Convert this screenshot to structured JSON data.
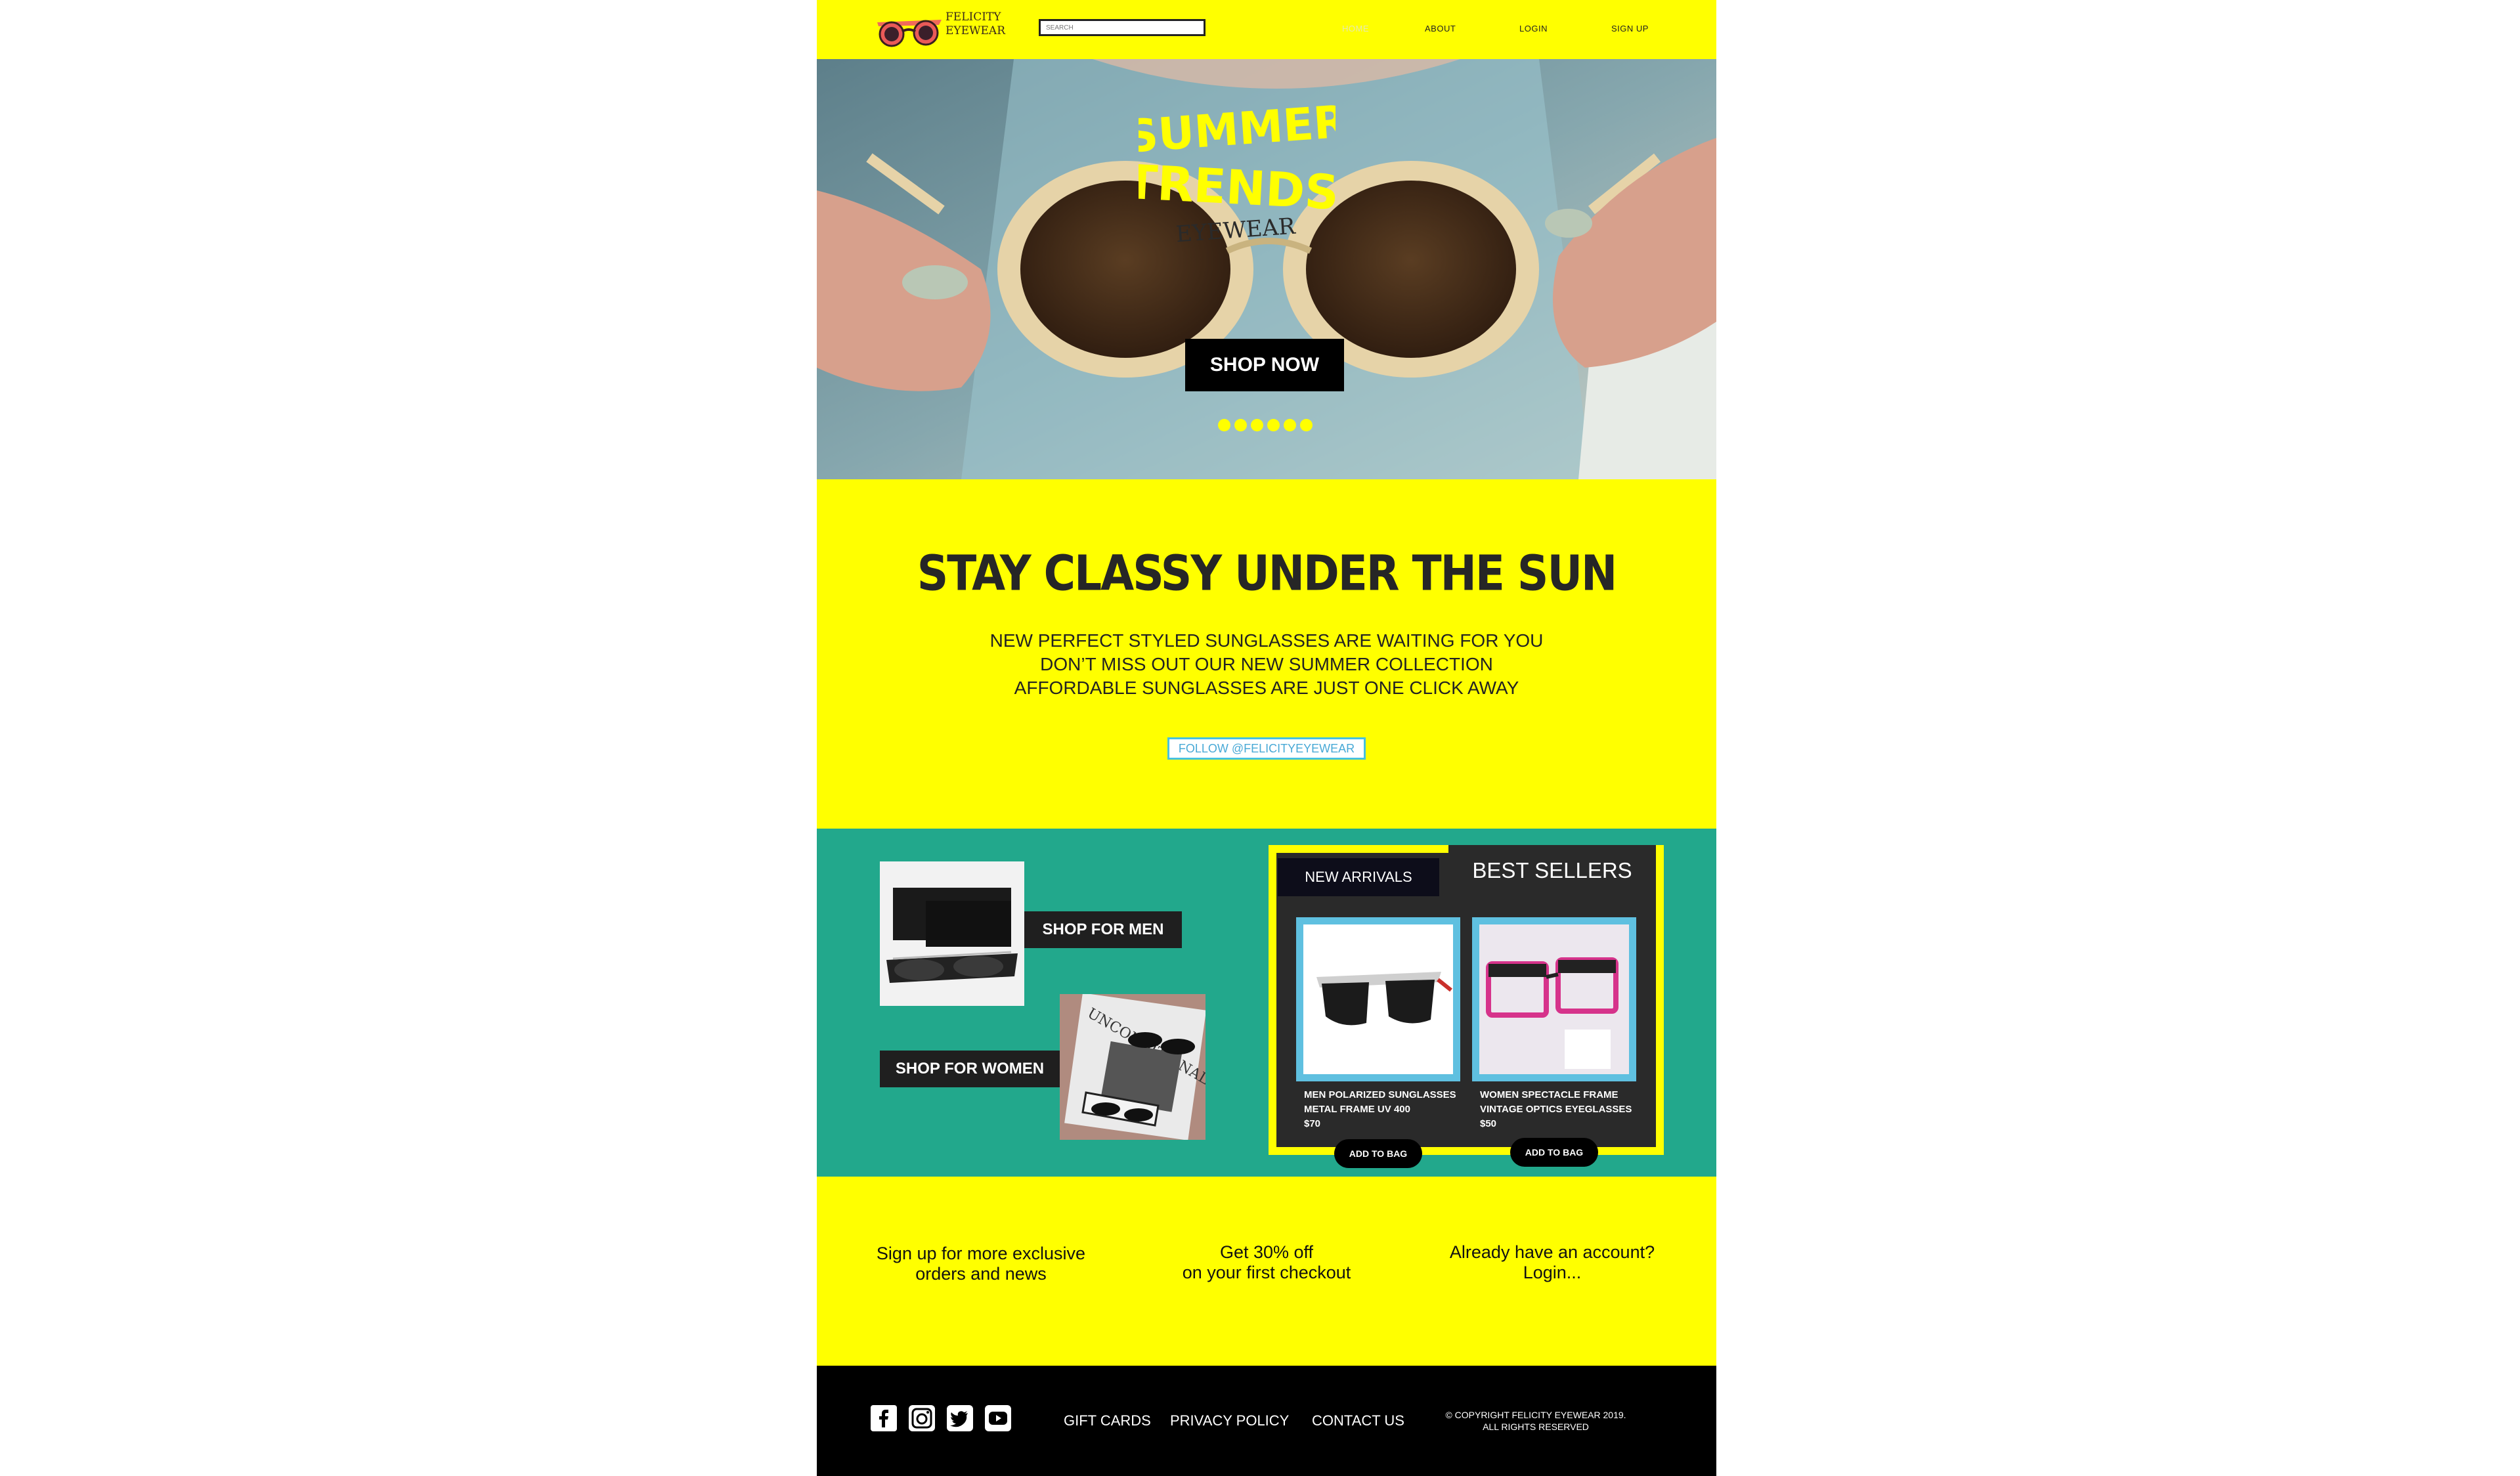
{
  "brand": {
    "line1": "FELICITY",
    "line2": "EYEWEAR"
  },
  "search": {
    "placeholder": "SEARCH"
  },
  "nav": {
    "items": [
      "HOME",
      "ABOUT",
      "LOGIN",
      "SIGN UP"
    ]
  },
  "hero": {
    "title_line1": "SUMMER",
    "title_line2": "TRENDS",
    "title_line3": "EYEWEAR",
    "cta": "SHOP NOW",
    "slide_count": 6
  },
  "intro": {
    "heading": "STAY CLASSY UNDER THE SUN",
    "lines": [
      "NEW PERFECT STYLED SUNGLASSES ARE WAITING FOR YOU",
      "DON’T MISS OUT OUR NEW SUMMER COLLECTION",
      "AFFORDABLE SUNGLASSES ARE JUST ONE CLICK AWAY"
    ],
    "follow": "FOLLOW @FELICITYEYEWEAR"
  },
  "shop": {
    "men_label": "SHOP FOR MEN",
    "women_label": "SHOP FOR WOMEN",
    "women_magazine_text": "UNCONDITIONAL",
    "tabs": {
      "new_arrivals": "NEW ARRIVALS",
      "best_sellers": "BEST SELLERS"
    },
    "products": [
      {
        "line1": "MEN POLARIZED SUNGLASSES",
        "line2": "METAL FRAME UV 400",
        "price": "$70",
        "button": "ADD TO BAG"
      },
      {
        "line1": "WOMEN SPECTACLE FRAME",
        "line2": "VINTAGE OPTICS EYEGLASSES",
        "price": "$50",
        "button": "ADD TO BAG"
      }
    ]
  },
  "cta": {
    "signup_line1": "Sign up for more exclusive",
    "signup_line2": "orders and news",
    "discount_line1": "Get 30% off",
    "discount_line2": "on your first checkout",
    "login_line1": "Already have an account?",
    "login_line2": "Login..."
  },
  "footer": {
    "social": [
      "facebook-icon",
      "instagram-icon",
      "twitter-icon",
      "youtube-icon"
    ],
    "links": [
      "GIFT CARDS",
      "PRIVACY POLICY",
      "CONTACT US"
    ],
    "copyright_line1": "© COPYRIGHT FELICITY EYEWEAR 2019.",
    "copyright_line2": "ALL RIGHTS RESERVED"
  },
  "colors": {
    "accent": "#ffff00",
    "teal": "#22a88c",
    "dark": "#000000",
    "frame_blue": "#5fc0e0"
  }
}
